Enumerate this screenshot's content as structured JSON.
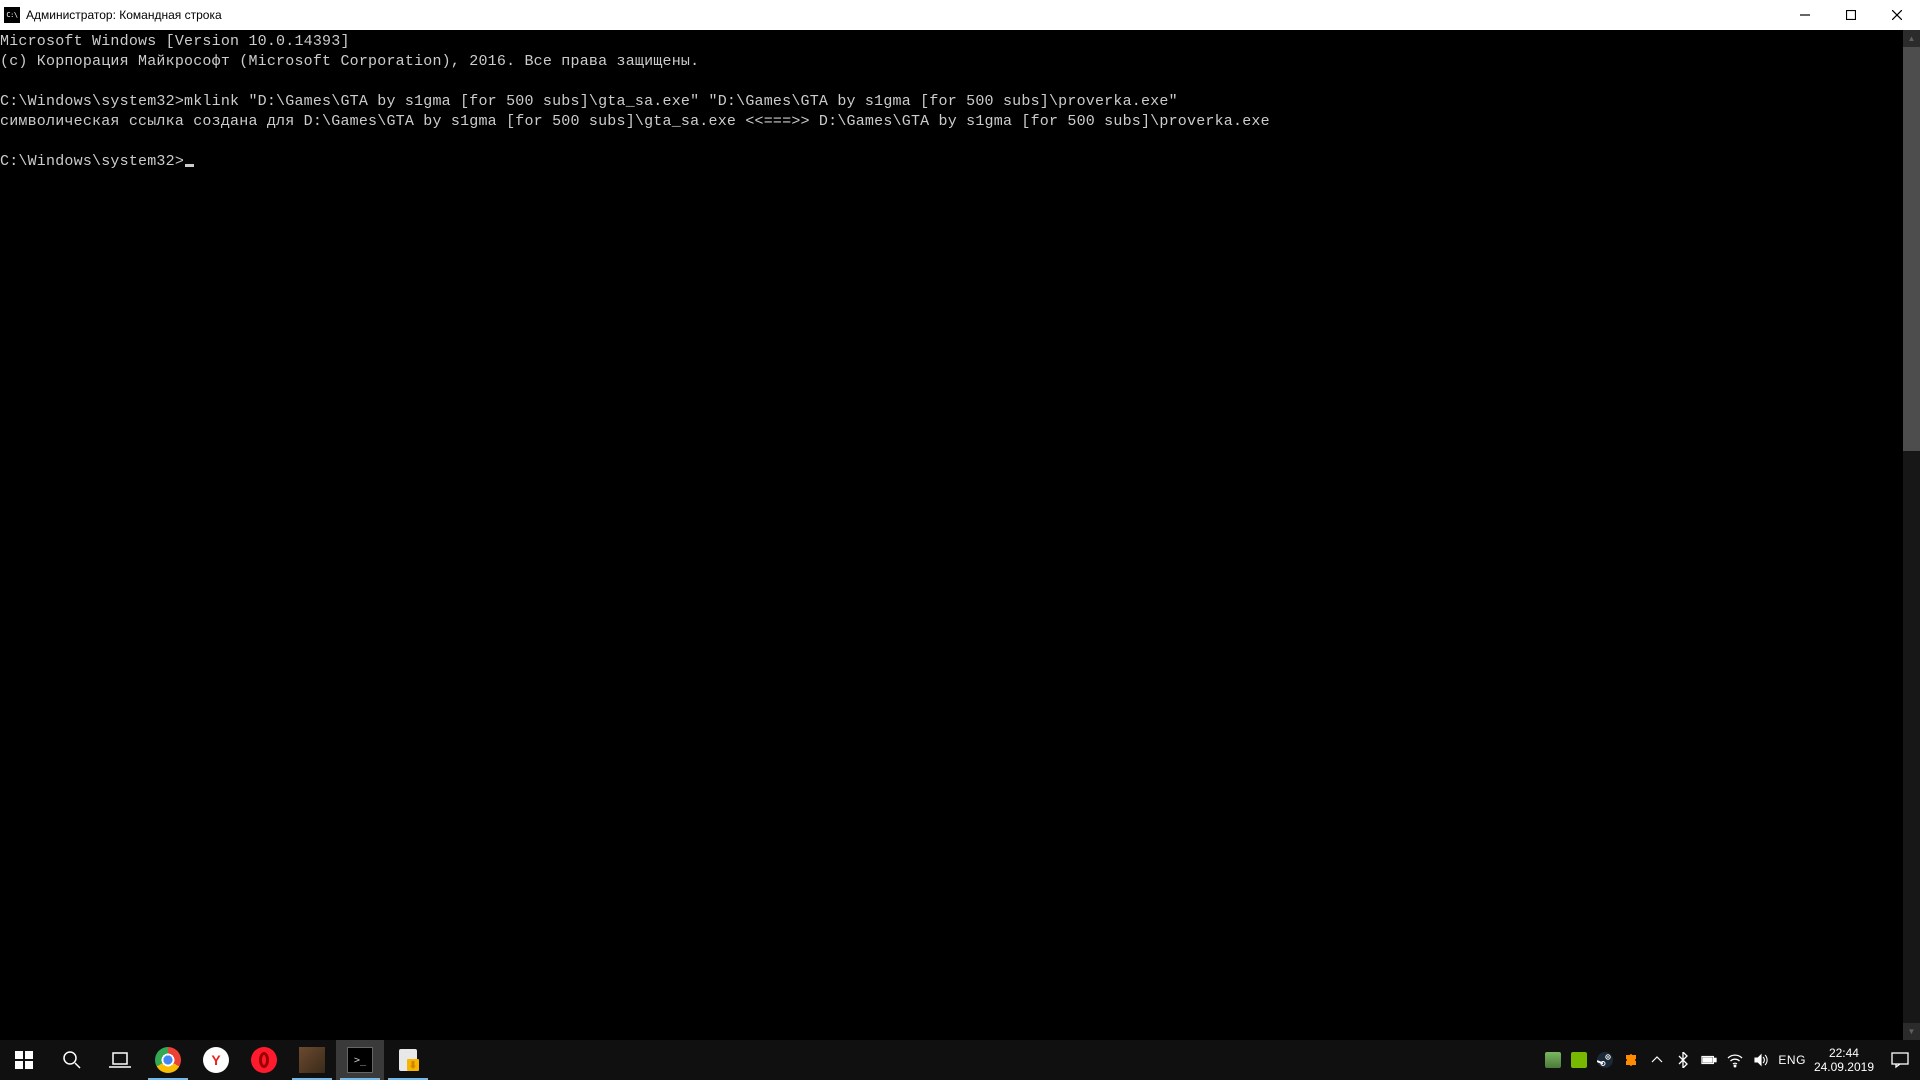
{
  "titlebar": {
    "icon_text": "C:\\",
    "title": "Администратор: Командная строка"
  },
  "terminal": {
    "line1": "Microsoft Windows [Version 10.0.14393]",
    "line2": "(c) Корпорация Майкрософт (Microsoft Corporation), 2016. Все права защищены.",
    "blank1": "",
    "line3": "C:\\Windows\\system32>mklink \"D:\\Games\\GTA by s1gma [for 500 subs]\\gta_sa.exe\" \"D:\\Games\\GTA by s1gma [for 500 subs]\\proverka.exe\"",
    "line4": "символическая ссылка создана для D:\\Games\\GTA by s1gma [for 500 subs]\\gta_sa.exe <<===>> D:\\Games\\GTA by s1gma [for 500 subs]\\proverka.exe",
    "blank2": "",
    "prompt": "C:\\Windows\\system32>"
  },
  "taskbar": {
    "lang": "ENG",
    "time": "22:44",
    "date": "24.09.2019"
  }
}
